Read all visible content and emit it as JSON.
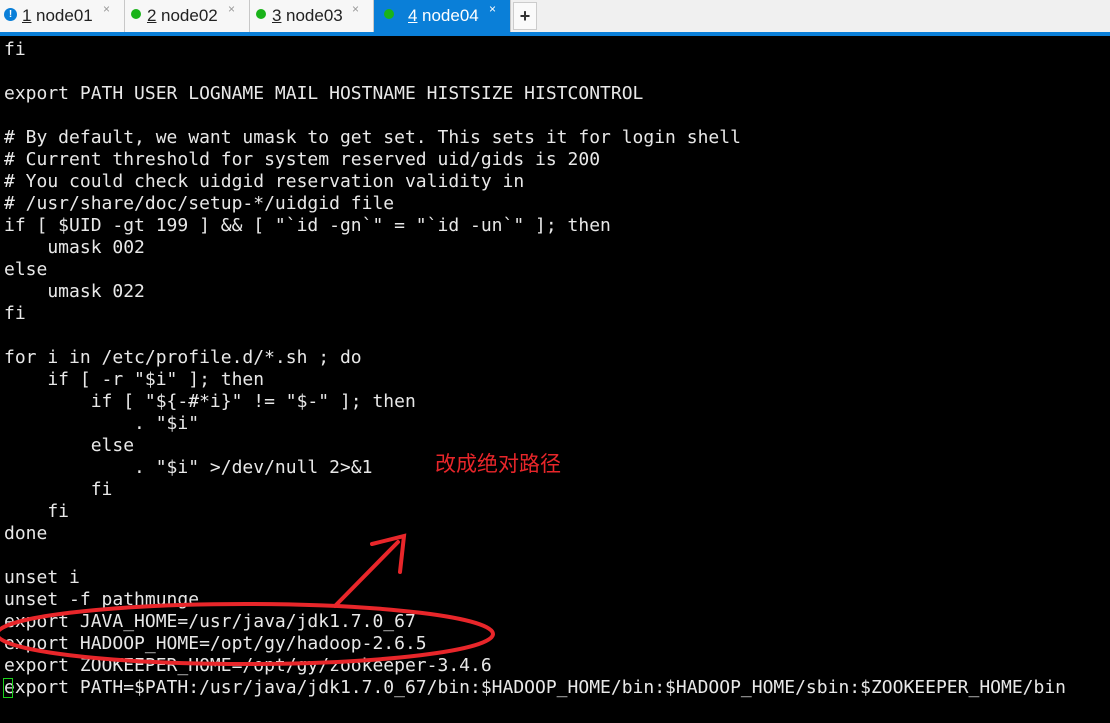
{
  "tabs": [
    {
      "num": "1",
      "label": "node01",
      "status": "warning",
      "close": "×"
    },
    {
      "num": "2",
      "label": "node02",
      "status": "connected",
      "close": "×"
    },
    {
      "num": "3",
      "label": "node03",
      "status": "connected",
      "close": "×"
    },
    {
      "num": "4",
      "label": "node04",
      "status": "connected",
      "close": "×",
      "active": true
    }
  ],
  "new_tab": "+",
  "terminal": {
    "lines": [
      "fi",
      "",
      "export PATH USER LOGNAME MAIL HOSTNAME HISTSIZE HISTCONTROL",
      "",
      "# By default, we want umask to get set. This sets it for login shell",
      "# Current threshold for system reserved uid/gids is 200",
      "# You could check uidgid reservation validity in",
      "# /usr/share/doc/setup-*/uidgid file",
      "if [ $UID -gt 199 ] && [ \"`id -gn`\" = \"`id -un`\" ]; then",
      "    umask 002",
      "else",
      "    umask 022",
      "fi",
      "",
      "for i in /etc/profile.d/*.sh ; do",
      "    if [ -r \"$i\" ]; then",
      "        if [ \"${-#*i}\" != \"$-\" ]; then",
      "            . \"$i\"",
      "        else",
      "            . \"$i\" >/dev/null 2>&1",
      "        fi",
      "    fi",
      "done",
      "",
      "unset i",
      "unset -f pathmunge",
      "export JAVA_HOME=/usr/java/jdk1.7.0_67",
      "export HADOOP_HOME=/opt/gy/hadoop-2.6.5",
      "export ZOOKEEPER_HOME=/opt/gy/zookeeper-3.4.6",
      "export PATH=$PATH:/usr/java/jdk1.7.0_67/bin:$HADOOP_HOME/bin:$HADOOP_HOME/sbin:$ZOOKEEPER_HOME/bin"
    ]
  },
  "annotation": {
    "text": "改成绝对路径",
    "color": "#e8262a"
  }
}
